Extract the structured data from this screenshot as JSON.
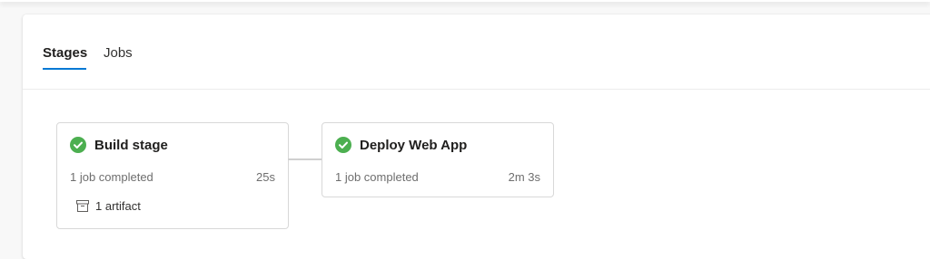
{
  "tabs": [
    {
      "label": "Stages",
      "active": true
    },
    {
      "label": "Jobs",
      "active": false
    }
  ],
  "stages": [
    {
      "name": "Build stage",
      "status": "1 job completed",
      "duration": "25s",
      "status_icon": "check-circle-icon",
      "artifact": {
        "icon": "artifact-box-icon",
        "label": "1 artifact"
      }
    },
    {
      "name": "Deploy Web App",
      "status": "1 job completed",
      "duration": "2m 3s",
      "status_icon": "check-circle-icon"
    }
  ],
  "colors": {
    "success": "#4caf50",
    "accent": "#0078d4",
    "border": "#d8d8d8",
    "muted_text": "#6e6e6e"
  }
}
